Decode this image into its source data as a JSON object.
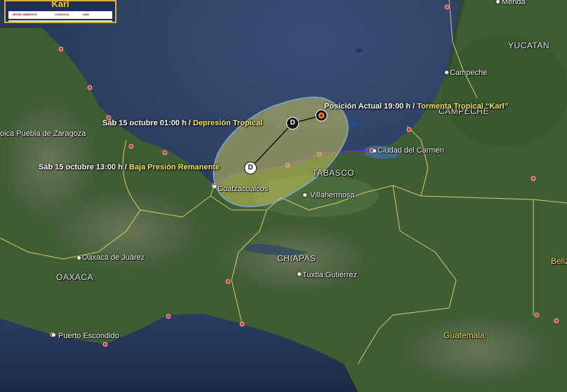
{
  "logo": {
    "storm_name": "Karl",
    "org_1": "MEDIO AMBIENTE",
    "org_2": "CONAGUA",
    "org_3": "SMN"
  },
  "regions": {
    "yucatan": "YUCATAN",
    "campeche": "CAMPECHE",
    "tabasco": "TABASCO",
    "chiapas": "CHIAPAS",
    "oaxaca": "OAXACA"
  },
  "countries": {
    "guatemala": "Guatemala",
    "belize": "Beliz"
  },
  "cities": {
    "merida": "Mérida",
    "campeche": "Campeche",
    "ciudad_del_carmen": "Ciudad del Carmen",
    "villahermosa": "Villahermosa",
    "coatzacoalcos": "Coatzacoalcos",
    "tuxtla_gutierrez": "Tuxtla Gutiérrez",
    "oaxaca_de_juarez": "Oaxaca de Juárez",
    "puerto_escondido": "Puerto Escondido",
    "puebla": "oica Puebla de Zaragoza"
  },
  "forecast": {
    "current_time": "Posición Actual 19:00 h",
    "current_status": "Tormenta Tropical “Karl”",
    "point1_time": "Sáb 15 octubre 01:00 h",
    "point1_status": "Depresión Tropical",
    "point1_marker": "D",
    "point2_time": "Sáb 15 octubre 13:00 h",
    "point2_status": "Baja Presión Remanente",
    "point2_marker": "D",
    "separator": " / "
  },
  "colors": {
    "sea": "#253553",
    "land": "#3f5c33",
    "cone_fill": "#c9c35a",
    "cone_stroke": "#7aa9d8",
    "warning_line": "#6a2fd6",
    "boundary": "#e8e27a",
    "label_yellow": "#f6e94a",
    "storm_marker": "#f07a1e"
  }
}
